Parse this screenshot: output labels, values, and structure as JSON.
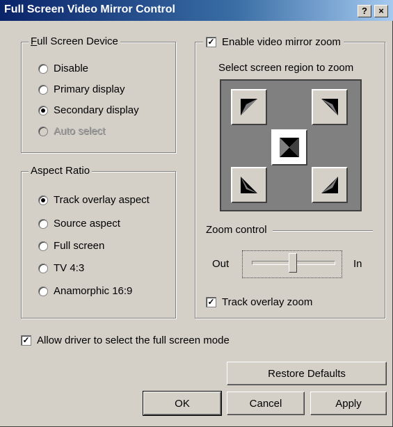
{
  "window": {
    "title": "Full Screen Video Mirror Control",
    "help_btn": "?",
    "close_btn": "×"
  },
  "device_group": {
    "legend": "Full Screen Device",
    "options": [
      {
        "label": "Disable",
        "selected": false,
        "enabled": true
      },
      {
        "label": "Primary display",
        "selected": false,
        "enabled": true
      },
      {
        "label": "Secondary display",
        "selected": true,
        "enabled": true
      },
      {
        "label": "Auto select",
        "selected": false,
        "enabled": false
      }
    ]
  },
  "aspect_group": {
    "legend": "Aspect Ratio",
    "options": [
      {
        "label": "Track overlay aspect",
        "selected": true
      },
      {
        "label": "Source aspect",
        "selected": false
      },
      {
        "label": "Full screen",
        "selected": false
      },
      {
        "label": "TV 4:3",
        "selected": false
      },
      {
        "label": "Anamorphic 16:9",
        "selected": false
      }
    ]
  },
  "zoom_group": {
    "enable_label": "Enable video mirror zoom",
    "enable_checked": true,
    "region_label": "Select screen region to zoom",
    "selected_region": "center",
    "zoom_control_label": "Zoom control",
    "out_label": "Out",
    "in_label": "In",
    "zoom_level": 0.5,
    "track_label": "Track overlay zoom",
    "track_checked": true
  },
  "allow_driver": {
    "label": "Allow driver to select the full screen mode",
    "checked": true
  },
  "buttons": {
    "restore": "Restore Defaults",
    "ok": "OK",
    "cancel": "Cancel",
    "apply": "Apply"
  }
}
